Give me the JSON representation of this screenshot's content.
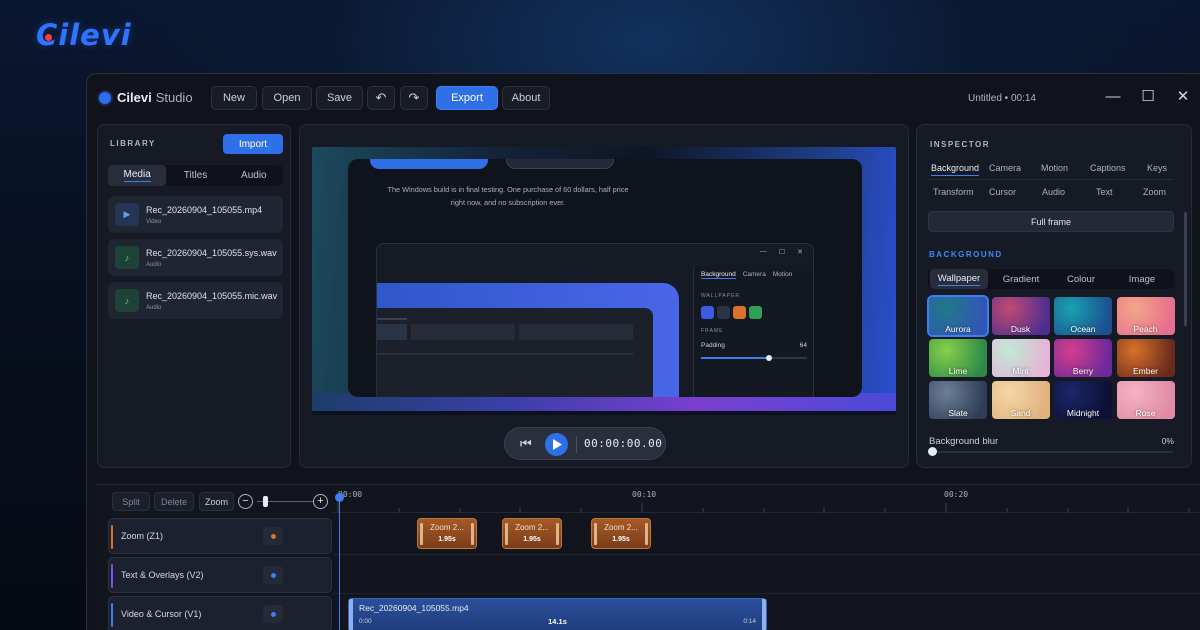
{
  "brand": {
    "name": "Cilevi"
  },
  "window": {
    "app_name": "Cilevi",
    "app_sub": "Studio",
    "toolbar": {
      "new": "New",
      "open": "Open",
      "save": "Save",
      "undo": "↶",
      "redo": "↷",
      "export": "Export",
      "about": "About"
    },
    "doc_title": "Untitled",
    "doc_sep": "•",
    "doc_time": "00:14",
    "controls": {
      "minimize": "—",
      "maximize": "☐",
      "close": "✕"
    }
  },
  "library": {
    "title": "LIBRARY",
    "import": "Import",
    "tabs": [
      "Media",
      "Titles",
      "Audio"
    ],
    "items": [
      {
        "name": "Rec_20260904_105055.mp4",
        "type": "Video",
        "icon": "▶"
      },
      {
        "name": "Rec_20260904_105055.sys.wav",
        "type": "Audio",
        "icon": "♪"
      },
      {
        "name": "Rec_20260904_105055.mic.wav",
        "type": "Audio",
        "icon": "♪"
      }
    ]
  },
  "preview": {
    "line1": "The Windows build is in final testing. One purchase of 60 dollars, half price",
    "line2": "right now, and no subscription ever.",
    "inner": {
      "controls": [
        "—",
        "☐",
        "✕"
      ],
      "tabs": [
        "Background",
        "Camera",
        "Motion"
      ],
      "wallpaper_label": "WALLPAPER",
      "frame_label": "FRAME",
      "padding_label": "Padding",
      "padding_value": "64",
      "padding_fraction": 0.64,
      "swatch_colors": [
        "#3d5ae0",
        "#2a3446",
        "#d9732a",
        "#2fa05a"
      ]
    },
    "timecode": "00:00:00.00"
  },
  "inspector": {
    "title": "INSPECTOR",
    "tabs_row1": [
      "Background",
      "Camera",
      "Motion",
      "Captions",
      "Keys"
    ],
    "tabs_row2": [
      "Transform",
      "Cursor",
      "Audio",
      "Text",
      "Zoom"
    ],
    "full_frame": "Full frame",
    "section": "BACKGROUND",
    "bg_tabs": [
      "Wallpaper",
      "Gradient",
      "Colour",
      "Image"
    ],
    "wallpapers": [
      {
        "name": "Aurora",
        "c1": "#1f7a8a",
        "c2": "#3355b5"
      },
      {
        "name": "Dusk",
        "c1": "#c24a72",
        "c2": "#4e2f8f"
      },
      {
        "name": "Ocean",
        "c1": "#18a3b0",
        "c2": "#1d4f8f"
      },
      {
        "name": "Peach",
        "c1": "#f3a58a",
        "c2": "#e66f8c"
      },
      {
        "name": "Lime",
        "c1": "#86d04a",
        "c2": "#2f8a48"
      },
      {
        "name": "Mint",
        "c1": "#bfe9d5",
        "c2": "#e6b4d6"
      },
      {
        "name": "Berry",
        "c1": "#d43e8e",
        "c2": "#6b2a9a"
      },
      {
        "name": "Ember",
        "c1": "#d8722a",
        "c2": "#6a2a1c"
      },
      {
        "name": "Slate",
        "c1": "#6d7f98",
        "c2": "#2f3d55"
      },
      {
        "name": "Sand",
        "c1": "#f2d7a5",
        "c2": "#e1b27d"
      },
      {
        "name": "Midnight",
        "c1": "#1c2668",
        "c2": "#0c1034"
      },
      {
        "name": "Rose",
        "c1": "#f3b3c2",
        "c2": "#e08aa6"
      }
    ],
    "blur_label": "Background blur",
    "blur_value": "0%",
    "blur_fraction": 0
  },
  "timeline": {
    "buttons": {
      "split": "Split",
      "delete": "Delete",
      "zoom": "Zoom"
    },
    "zoom_out": "−",
    "zoom_in": "+",
    "zoom_level": 0.15,
    "ruler": [
      "00:00",
      "00:10",
      "00:20"
    ],
    "tracks": [
      {
        "name": "Zoom (Z1)",
        "color": "#d9732a"
      },
      {
        "name": "Text & Overlays (V2)",
        "color": "#8a4fe0"
      },
      {
        "name": "Video & Cursor (V1)",
        "color": "#3e7ef0"
      }
    ],
    "zoom_clips": [
      {
        "label": "Zoom 2...",
        "dur": "1.95s"
      },
      {
        "label": "Zoom 2...",
        "dur": "1.95s"
      },
      {
        "label": "Zoom 2...",
        "dur": "1.95s"
      }
    ],
    "video_clip": {
      "name": "Rec_20260904_105055.mp4",
      "start": "0:00",
      "dur": "14.1s",
      "end": "0:14"
    }
  }
}
